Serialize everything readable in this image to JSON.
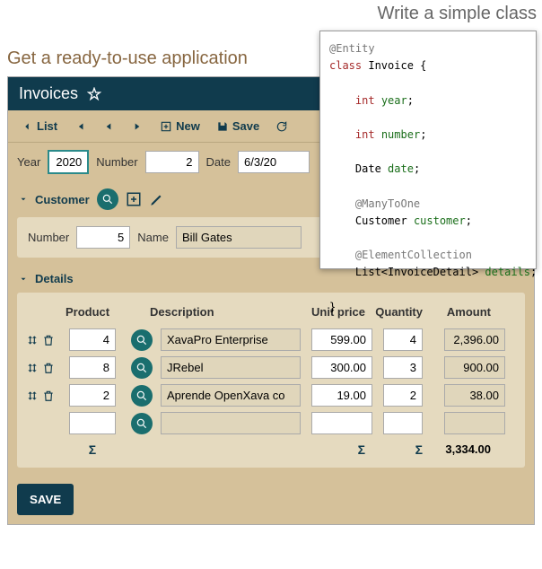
{
  "headings": {
    "writeClass": "Write a simple class",
    "getApp": "Get a ready-to-use application"
  },
  "app": {
    "title": "Invoices",
    "toolbar": {
      "list": "List",
      "new": "New",
      "save": "Save"
    },
    "form": {
      "yearLabel": "Year",
      "yearValue": "2020",
      "numberLabel": "Number",
      "numberValue": "2",
      "dateLabel": "Date",
      "dateValue": "6/3/20"
    },
    "customer": {
      "title": "Customer",
      "numberLabel": "Number",
      "numberValue": "5",
      "nameLabel": "Name",
      "nameValue": "Bill Gates"
    },
    "details": {
      "title": "Details",
      "headers": {
        "product": "Product",
        "description": "Description",
        "unit": "Unit price",
        "qty": "Quantity",
        "amount": "Amount"
      },
      "rows": [
        {
          "product": "4",
          "desc": "XavaPro Enterprise",
          "unit": "599.00",
          "qty": "4",
          "amount": "2,396.00"
        },
        {
          "product": "8",
          "desc": "JRebel",
          "unit": "300.00",
          "qty": "3",
          "amount": "900.00"
        },
        {
          "product": "2",
          "desc": "Aprende OpenXava co",
          "unit": "19.00",
          "qty": "2",
          "amount": "38.00"
        }
      ],
      "total": "3,334.00"
    },
    "saveButton": "SAVE"
  },
  "code": {
    "entity": "@Entity",
    "cls": "class",
    "clsName": "Invoice",
    "int": "int",
    "year": "year",
    "number": "number",
    "dateType": "Date",
    "date": "date",
    "m2o": "@ManyToOne",
    "custType": "Customer",
    "cust": "customer",
    "elc": "@ElementCollection",
    "listType": "List<InvoiceDetail>",
    "details": "details"
  }
}
